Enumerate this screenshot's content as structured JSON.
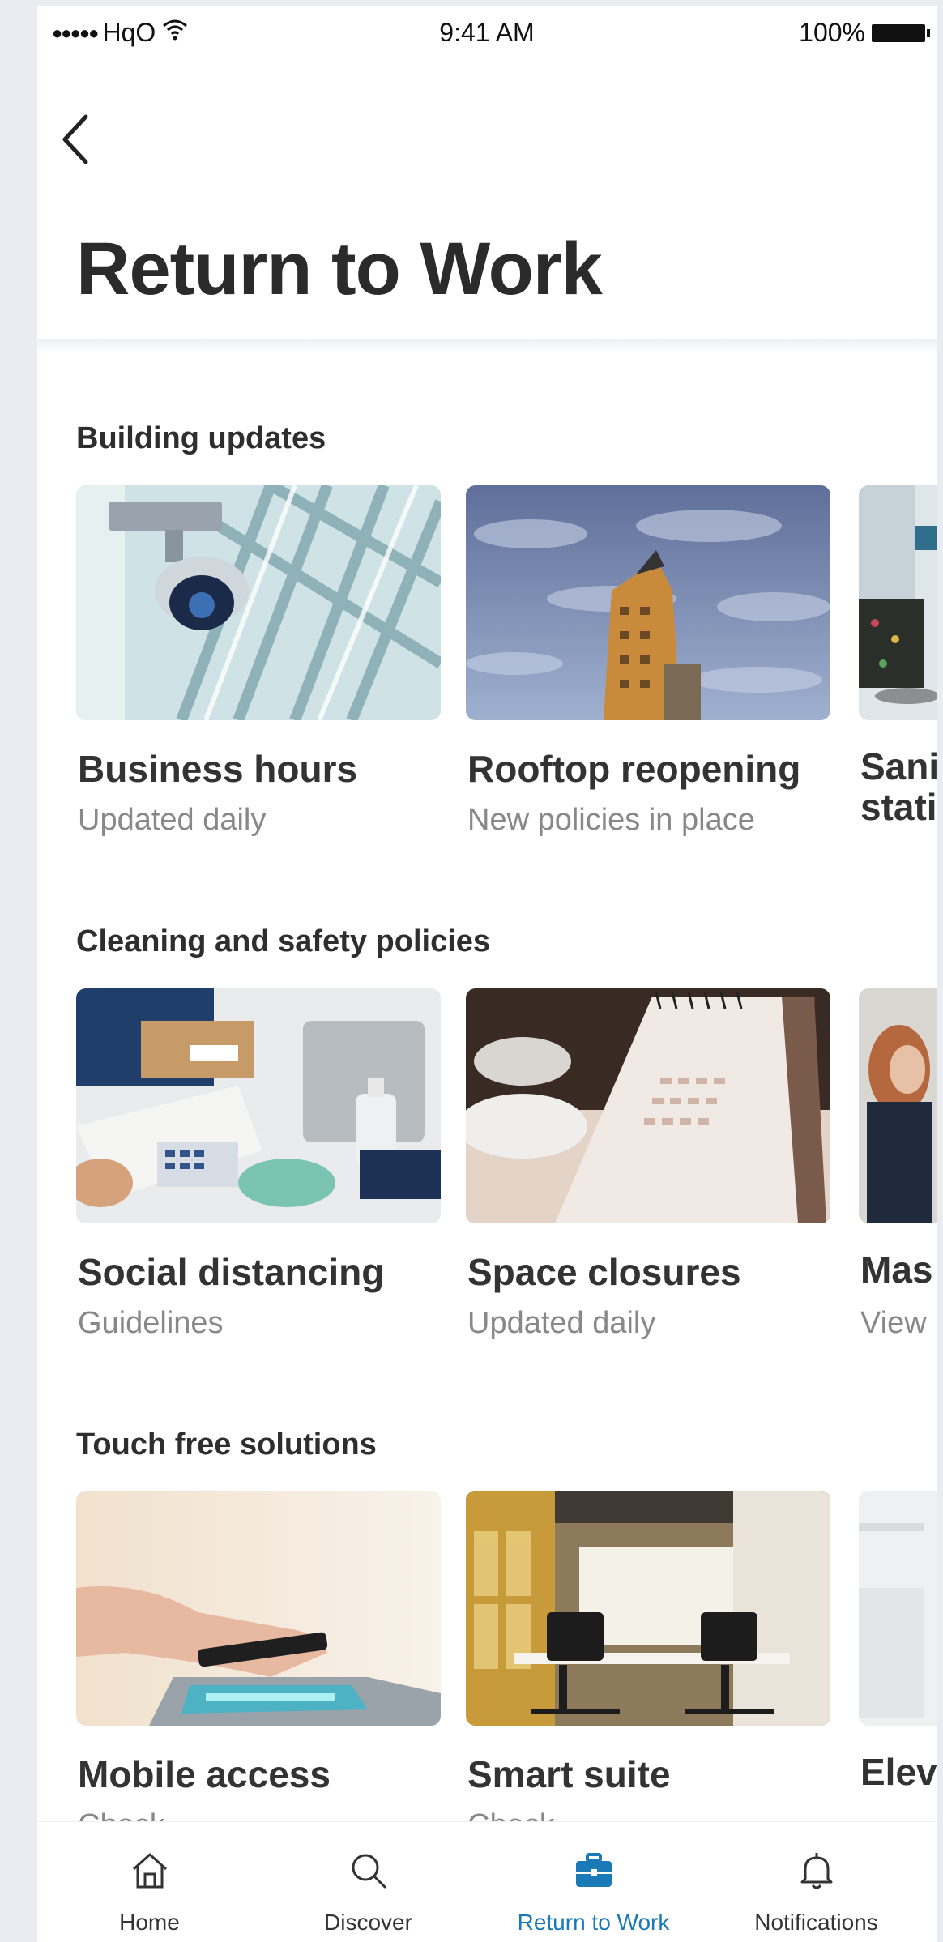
{
  "status_bar": {
    "carrier": "HqO",
    "time": "9:41 AM",
    "battery": "100%"
  },
  "page": {
    "title": "Return to Work"
  },
  "sections": [
    {
      "title": "Building updates",
      "cards": [
        {
          "title": "Business hours",
          "subtitle": "Updated daily"
        },
        {
          "title": "Rooftop reopening",
          "subtitle": "New policies in place"
        },
        {
          "title": "Sani stati",
          "subtitle": ""
        }
      ]
    },
    {
      "title": "Cleaning and safety policies",
      "cards": [
        {
          "title": "Social distancing",
          "subtitle": "Guidelines"
        },
        {
          "title": "Space closures",
          "subtitle": "Updated daily"
        },
        {
          "title": "Mas",
          "subtitle": "View"
        }
      ]
    },
    {
      "title": "Touch free solutions",
      "cards": [
        {
          "title": "Mobile access",
          "subtitle": "Check"
        },
        {
          "title": "Smart suite",
          "subtitle": "Check"
        },
        {
          "title": "Elev",
          "subtitle": ""
        }
      ]
    }
  ],
  "tabbar": {
    "items": [
      {
        "label": "Home",
        "icon": "home-icon"
      },
      {
        "label": "Discover",
        "icon": "search-icon"
      },
      {
        "label": "Return to Work",
        "icon": "briefcase-icon"
      },
      {
        "label": "Notifications",
        "icon": "bell-icon"
      }
    ],
    "active_index": 2,
    "active_color": "#1a7ab8"
  }
}
